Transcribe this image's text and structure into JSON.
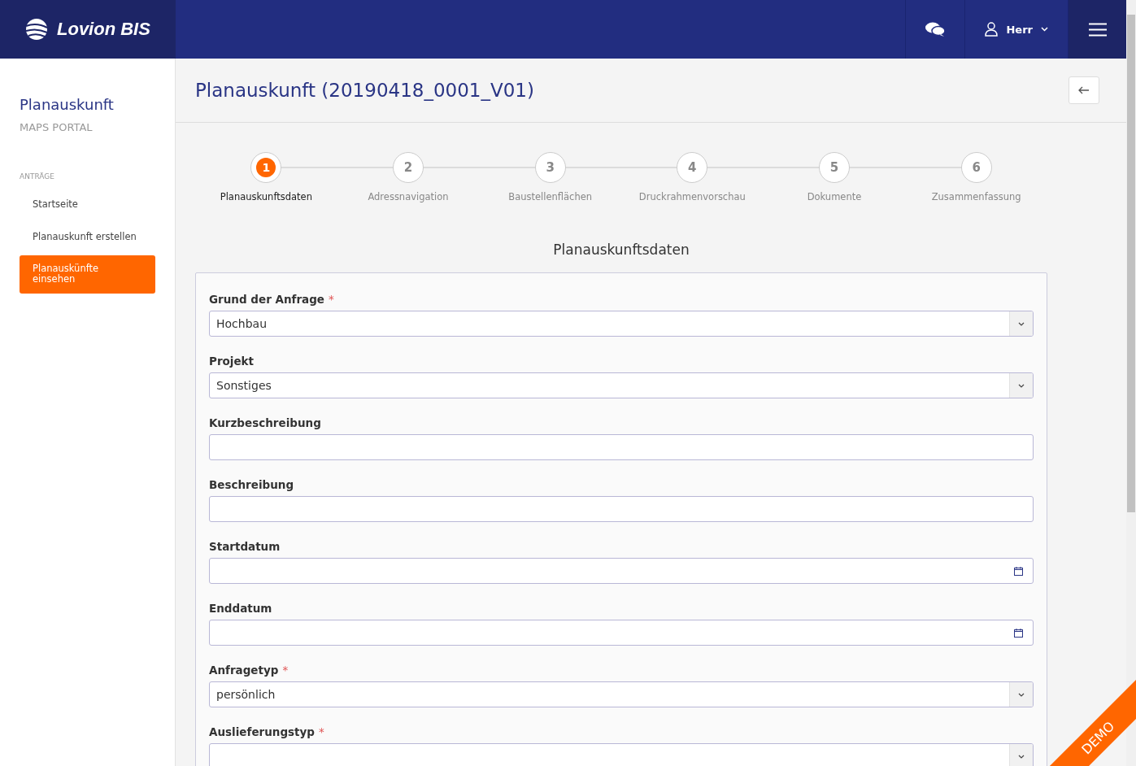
{
  "header": {
    "brand": "Lovion BIS",
    "user": "Herr"
  },
  "sidebar": {
    "title": "Planauskunft",
    "subtitle": "MAPS PORTAL",
    "section": "ANTRÄGE",
    "items": [
      {
        "label": "Startseite",
        "selected": false
      },
      {
        "label": "Planauskunft erstellen",
        "selected": false
      },
      {
        "label": "Planauskünfte einsehen",
        "selected": true
      }
    ]
  },
  "page": {
    "title": "Planauskunft (20190418_0001_V01)"
  },
  "steps": [
    {
      "number": "1",
      "label": "Planauskunftsdaten",
      "selected": true
    },
    {
      "number": "2",
      "label": "Adressnavigation",
      "selected": false
    },
    {
      "number": "3",
      "label": "Baustellenflächen",
      "selected": false
    },
    {
      "number": "4",
      "label": "Druckrahmenvorschau",
      "selected": false
    },
    {
      "number": "5",
      "label": "Dokumente",
      "selected": false
    },
    {
      "number": "6",
      "label": "Zusammenfassung",
      "selected": false
    }
  ],
  "form": {
    "title": "Planauskunftsdaten",
    "fields": [
      {
        "kind": "select",
        "label": "Grund der Anfrage",
        "required_mark": "*",
        "value": "Hochbau"
      },
      {
        "kind": "select",
        "label": "Projekt",
        "value": "Sonstiges"
      },
      {
        "kind": "text",
        "label": "Kurzbeschreibung"
      },
      {
        "kind": "text",
        "label": "Beschreibung"
      },
      {
        "kind": "date",
        "label": "Startdatum"
      },
      {
        "kind": "date",
        "label": "Enddatum"
      },
      {
        "kind": "select",
        "label": "Anfragetyp",
        "required_mark": "*",
        "value": "persönlich"
      },
      {
        "kind": "select",
        "label": "Auslieferungstyp",
        "required_mark": "*"
      }
    ]
  },
  "demo_ribbon": "DEMO"
}
